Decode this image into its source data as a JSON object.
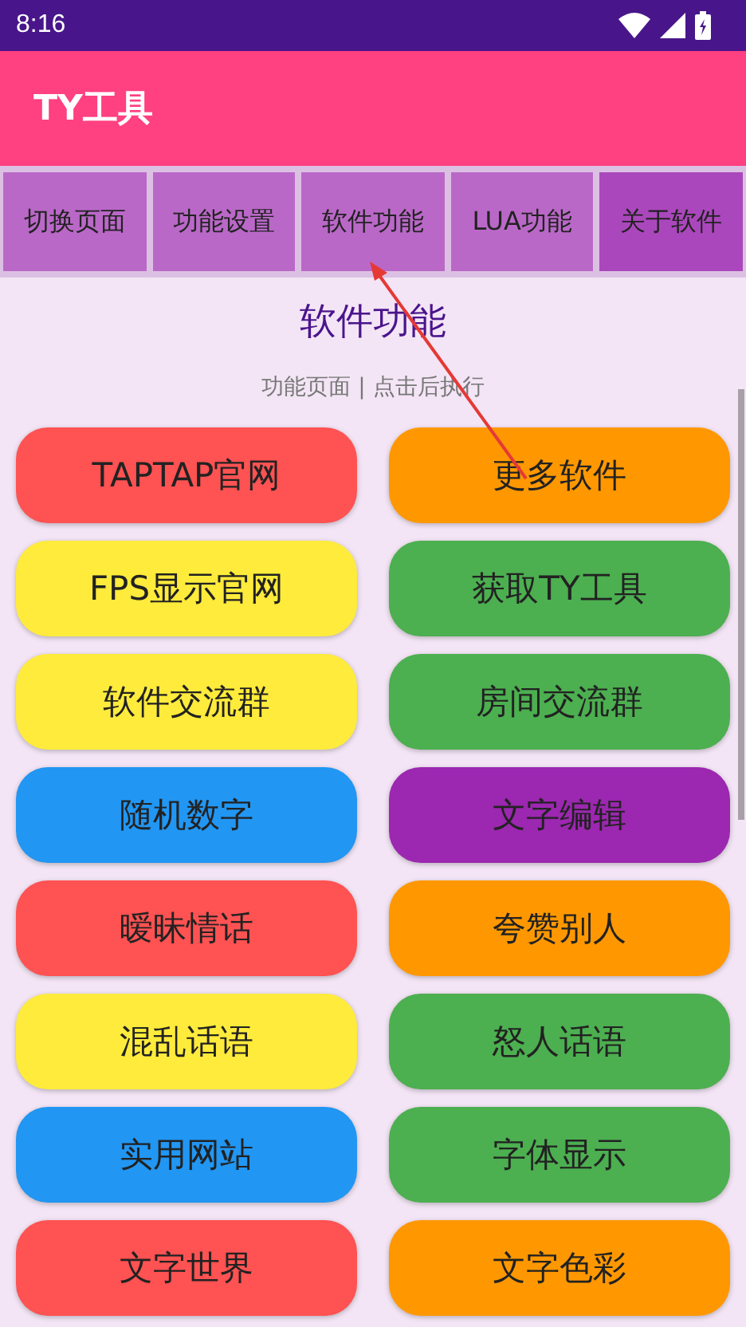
{
  "status_bar": {
    "time": "8:16"
  },
  "app_bar": {
    "title": "TY工具"
  },
  "tabs": [
    {
      "label": "切换页面",
      "selected": false
    },
    {
      "label": "功能设置",
      "selected": false
    },
    {
      "label": "软件功能",
      "selected": false
    },
    {
      "label": "LUA功能",
      "selected": false
    },
    {
      "label": "关于软件",
      "selected": true
    }
  ],
  "page": {
    "title": "软件功能",
    "subtitle": "功能页面 | 点击后执行"
  },
  "buttons": [
    {
      "label": "TAPTAP官网",
      "color": "#ff5252"
    },
    {
      "label": "更多软件",
      "color": "#ff9800"
    },
    {
      "label": "FPS显示官网",
      "color": "#ffeb3b"
    },
    {
      "label": "获取TY工具",
      "color": "#4caf50"
    },
    {
      "label": "软件交流群",
      "color": "#ffeb3b"
    },
    {
      "label": "房间交流群",
      "color": "#4caf50"
    },
    {
      "label": "随机数字",
      "color": "#2196f3"
    },
    {
      "label": "文字编辑",
      "color": "#9c27b0"
    },
    {
      "label": "暧昧情话",
      "color": "#ff5252"
    },
    {
      "label": "夸赞别人",
      "color": "#ff9800"
    },
    {
      "label": "混乱话语",
      "color": "#ffeb3b"
    },
    {
      "label": "怒人话语",
      "color": "#4caf50"
    },
    {
      "label": "实用网站",
      "color": "#2196f3"
    },
    {
      "label": "字体显示",
      "color": "#4caf50"
    },
    {
      "label": "文字世界",
      "color": "#ff5252"
    },
    {
      "label": "文字色彩",
      "color": "#ff9800"
    }
  ]
}
